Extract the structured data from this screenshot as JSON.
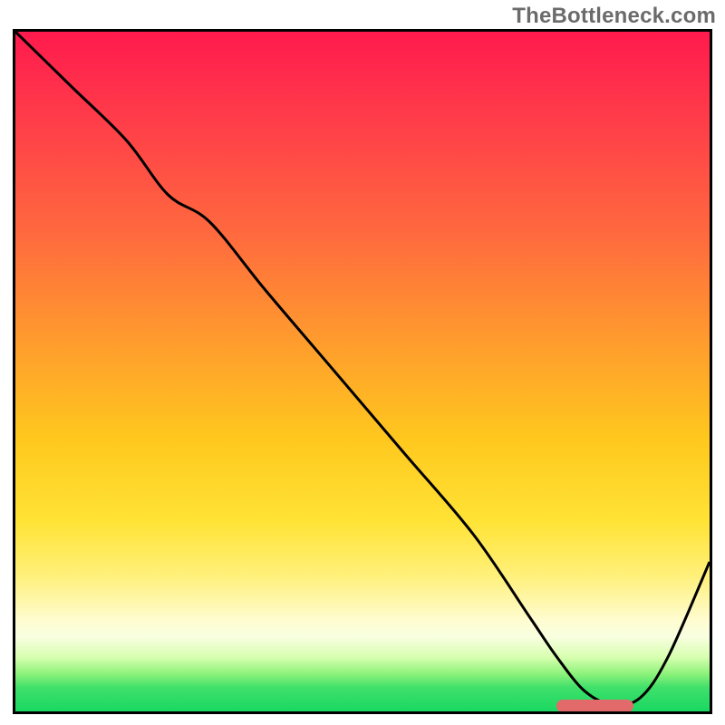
{
  "watermark": "TheBottleneck.com",
  "chart_data": {
    "type": "line",
    "title": "",
    "xlabel": "",
    "ylabel": "",
    "xlim": [
      0,
      100
    ],
    "ylim": [
      0,
      100
    ],
    "grid": false,
    "legend": false,
    "background_gradient": {
      "orientation": "vertical",
      "stops": [
        {
          "pos": 0,
          "color": "#ff1a4d"
        },
        {
          "pos": 30,
          "color": "#ff6a3e"
        },
        {
          "pos": 60,
          "color": "#ffc81e"
        },
        {
          "pos": 80,
          "color": "#fff07a"
        },
        {
          "pos": 90,
          "color": "#f8ffe0"
        },
        {
          "pos": 96,
          "color": "#5fe86f"
        },
        {
          "pos": 100,
          "color": "#19d862"
        }
      ]
    },
    "series": [
      {
        "name": "bottleneck-curve",
        "color": "#000000",
        "stroke_width": 3,
        "x": [
          0,
          8,
          16,
          22,
          28,
          36,
          46,
          56,
          66,
          74,
          78,
          82,
          86,
          90,
          94,
          100
        ],
        "y": [
          100,
          92,
          84,
          76,
          72,
          62,
          50,
          38,
          26,
          14,
          8,
          3,
          1,
          2,
          8,
          22
        ]
      }
    ],
    "annotations": [
      {
        "name": "optimal-range-marker",
        "type": "bar",
        "color": "#e26a6a",
        "y": 0.8,
        "x_start": 78,
        "x_end": 89
      }
    ]
  }
}
